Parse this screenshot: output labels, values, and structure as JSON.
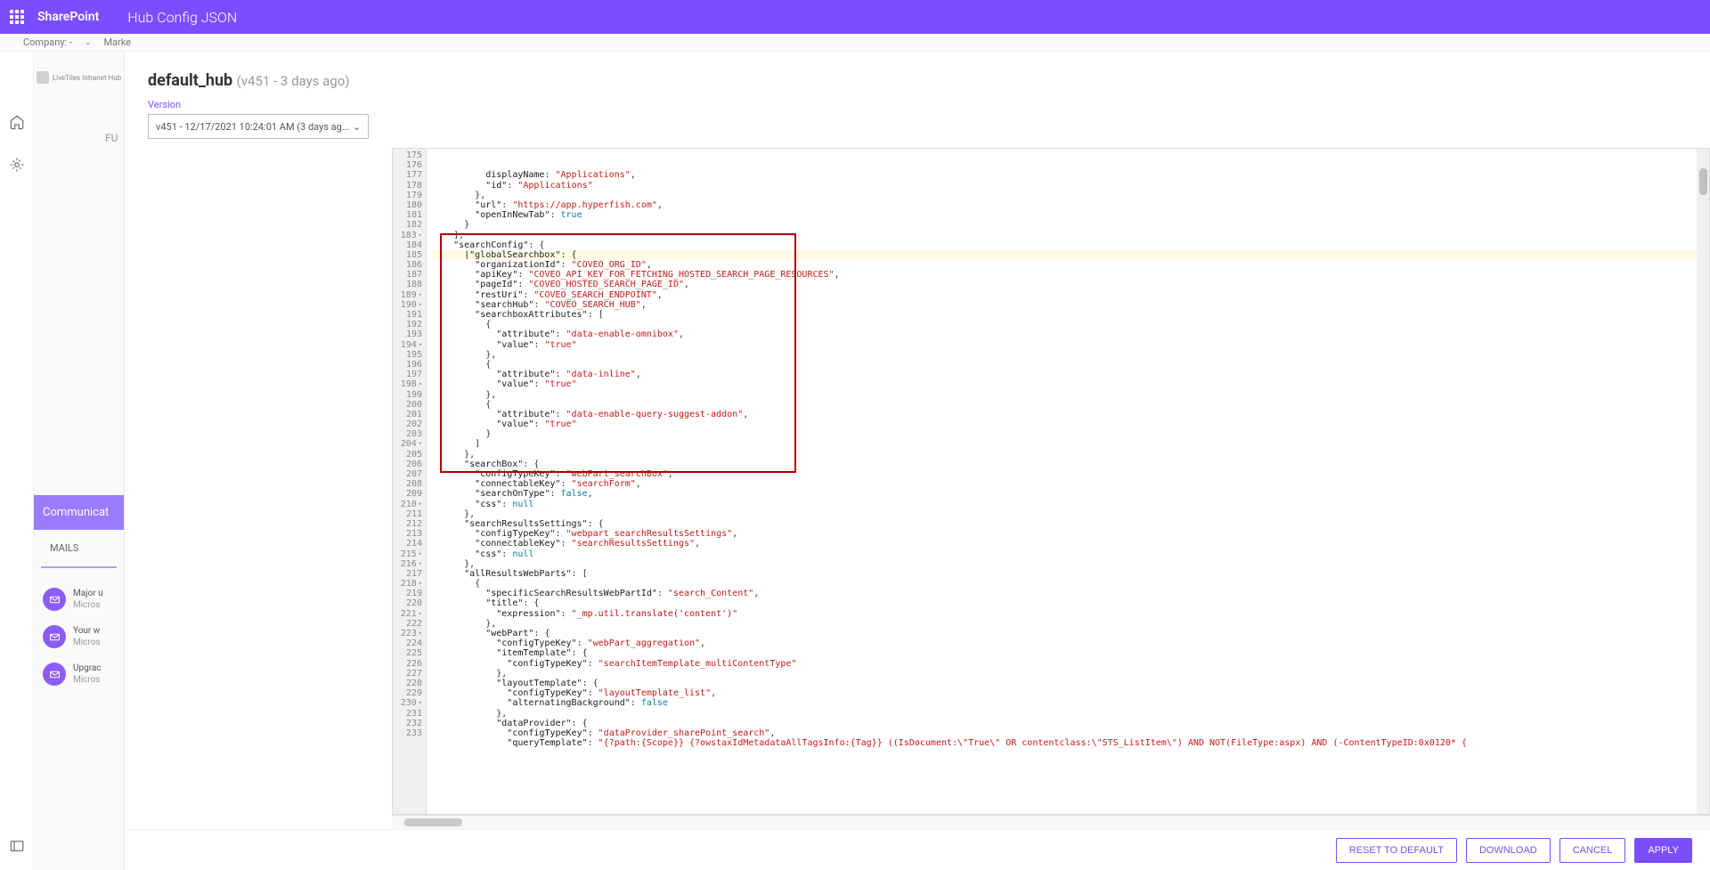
{
  "banner": {
    "brand": "SharePoint",
    "title": "Hub Config JSON"
  },
  "subBanner": {
    "company": "Company: -",
    "marke": "Marke"
  },
  "leftCol": {
    "logo": "LiveTiles Intranet Hub",
    "fu": "FU",
    "comm": "Communicat",
    "mails": "MAILS",
    "items": [
      {
        "t1": "Major u",
        "t2": "Micros"
      },
      {
        "t1": "Your w",
        "t2": "Micros"
      },
      {
        "t1": "Upgrac",
        "t2": "Micros"
      }
    ]
  },
  "panel": {
    "name": "default_hub",
    "sub": "(v451 - 3 days ago)",
    "versionLabel": "Version",
    "versionValue": "v451 - 12/17/2021 10:24:01 AM (3 days ag..."
  },
  "footer": {
    "reset": "RESET TO DEFAULT",
    "download": "DOWNLOAD",
    "cancel": "CANCEL",
    "apply": "APPLY"
  },
  "code": {
    "startLine": 175,
    "foldLines": [
      183,
      189,
      190,
      194,
      198,
      204,
      210,
      215,
      216,
      218,
      221,
      223,
      230
    ],
    "highlightLine": 183,
    "lines": [
      [
        [
          10,
          "k",
          "displayName"
        ],
        [
          0,
          "p",
          ": "
        ],
        [
          0,
          "s",
          "\"Applications\""
        ],
        [
          0,
          "p",
          ","
        ]
      ],
      [
        [
          10,
          "k",
          "\"id\""
        ],
        [
          0,
          "p",
          ": "
        ],
        [
          0,
          "s",
          "\"Applications\""
        ]
      ],
      [
        [
          8,
          "p",
          "},"
        ]
      ],
      [
        [
          8,
          "k",
          "\"url\""
        ],
        [
          0,
          "p",
          ": "
        ],
        [
          0,
          "s",
          "\"https://app.hyperfish.com\""
        ],
        [
          0,
          "p",
          ","
        ]
      ],
      [
        [
          8,
          "k",
          "\"openInNewTab\""
        ],
        [
          0,
          "p",
          ": "
        ],
        [
          0,
          "b",
          "true"
        ]
      ],
      [
        [
          6,
          "p",
          "}"
        ]
      ],
      [
        [
          4,
          "p",
          "],"
        ]
      ],
      [
        [
          4,
          "k",
          "\"searchConfig\""
        ],
        [
          0,
          "p",
          ": {"
        ]
      ],
      [
        [
          6,
          "k",
          "|\"globalSearchbox\""
        ],
        [
          0,
          "p",
          ": {"
        ]
      ],
      [
        [
          8,
          "k",
          "\"organizationId\""
        ],
        [
          0,
          "p",
          ": "
        ],
        [
          0,
          "s",
          "\"COVEO_ORG_ID\""
        ],
        [
          0,
          "p",
          ","
        ]
      ],
      [
        [
          8,
          "k",
          "\"apiKey\""
        ],
        [
          0,
          "p",
          ": "
        ],
        [
          0,
          "s",
          "\"COVEO_API_KEY_FOR_FETCHING_HOSTED_SEARCH_PAGE_RESOURCES\""
        ],
        [
          0,
          "p",
          ","
        ]
      ],
      [
        [
          8,
          "k",
          "\"pageId\""
        ],
        [
          0,
          "p",
          ": "
        ],
        [
          0,
          "s",
          "\"COVEO_HOSTED_SEARCH_PAGE_ID\""
        ],
        [
          0,
          "p",
          ","
        ]
      ],
      [
        [
          8,
          "k",
          "\"restUri\""
        ],
        [
          0,
          "p",
          ": "
        ],
        [
          0,
          "s",
          "\"COVEO_SEARCH_ENDPOINT\""
        ],
        [
          0,
          "p",
          ","
        ]
      ],
      [
        [
          8,
          "k",
          "\"searchHub\""
        ],
        [
          0,
          "p",
          ": "
        ],
        [
          0,
          "s",
          "\"COVEO_SEARCH_HUB\""
        ],
        [
          0,
          "p",
          ","
        ]
      ],
      [
        [
          8,
          "k",
          "\"searchboxAttributes\""
        ],
        [
          0,
          "p",
          ": ["
        ]
      ],
      [
        [
          10,
          "p",
          "{"
        ]
      ],
      [
        [
          12,
          "k",
          "\"attribute\""
        ],
        [
          0,
          "p",
          ": "
        ],
        [
          0,
          "s",
          "\"data-enable-omnibox\""
        ],
        [
          0,
          "p",
          ","
        ]
      ],
      [
        [
          12,
          "k",
          "\"value\""
        ],
        [
          0,
          "p",
          ": "
        ],
        [
          0,
          "s",
          "\"true\""
        ]
      ],
      [
        [
          10,
          "p",
          "},"
        ]
      ],
      [
        [
          10,
          "p",
          "{"
        ]
      ],
      [
        [
          12,
          "k",
          "\"attribute\""
        ],
        [
          0,
          "p",
          ": "
        ],
        [
          0,
          "s",
          "\"data-inline\""
        ],
        [
          0,
          "p",
          ","
        ]
      ],
      [
        [
          12,
          "k",
          "\"value\""
        ],
        [
          0,
          "p",
          ": "
        ],
        [
          0,
          "s",
          "\"true\""
        ]
      ],
      [
        [
          10,
          "p",
          "},"
        ]
      ],
      [
        [
          10,
          "p",
          "{"
        ]
      ],
      [
        [
          12,
          "k",
          "\"attribute\""
        ],
        [
          0,
          "p",
          ": "
        ],
        [
          0,
          "s",
          "\"data-enable-query-suggest-addon\""
        ],
        [
          0,
          "p",
          ","
        ]
      ],
      [
        [
          12,
          "k",
          "\"value\""
        ],
        [
          0,
          "p",
          ": "
        ],
        [
          0,
          "s",
          "\"true\""
        ]
      ],
      [
        [
          10,
          "p",
          "}"
        ]
      ],
      [
        [
          8,
          "p",
          "]"
        ]
      ],
      [
        [
          6,
          "p",
          "},"
        ]
      ],
      [
        [
          6,
          "k",
          "\"searchBox\""
        ],
        [
          0,
          "p",
          ": {"
        ]
      ],
      [
        [
          8,
          "k",
          "\"configTypeKey\""
        ],
        [
          0,
          "p",
          ": "
        ],
        [
          0,
          "s",
          "\"webPart_searchBox\""
        ],
        [
          0,
          "p",
          ","
        ]
      ],
      [
        [
          8,
          "k",
          "\"connectableKey\""
        ],
        [
          0,
          "p",
          ": "
        ],
        [
          0,
          "s",
          "\"searchForm\""
        ],
        [
          0,
          "p",
          ","
        ]
      ],
      [
        [
          8,
          "k",
          "\"searchOnType\""
        ],
        [
          0,
          "p",
          ": "
        ],
        [
          0,
          "b",
          "false"
        ],
        [
          0,
          "p",
          ","
        ]
      ],
      [
        [
          8,
          "k",
          "\"css\""
        ],
        [
          0,
          "p",
          ": "
        ],
        [
          0,
          "b",
          "null"
        ]
      ],
      [
        [
          6,
          "p",
          "},"
        ]
      ],
      [
        [
          6,
          "k",
          "\"searchResultsSettings\""
        ],
        [
          0,
          "p",
          ": {"
        ]
      ],
      [
        [
          8,
          "k",
          "\"configTypeKey\""
        ],
        [
          0,
          "p",
          ": "
        ],
        [
          0,
          "s",
          "\"webpart_searchResultsSettings\""
        ],
        [
          0,
          "p",
          ","
        ]
      ],
      [
        [
          8,
          "k",
          "\"connectableKey\""
        ],
        [
          0,
          "p",
          ": "
        ],
        [
          0,
          "s",
          "\"searchResultsSettings\""
        ],
        [
          0,
          "p",
          ","
        ]
      ],
      [
        [
          8,
          "k",
          "\"css\""
        ],
        [
          0,
          "p",
          ": "
        ],
        [
          0,
          "b",
          "null"
        ]
      ],
      [
        [
          6,
          "p",
          "},"
        ]
      ],
      [
        [
          6,
          "k",
          "\"allResultsWebParts\""
        ],
        [
          0,
          "p",
          ": ["
        ]
      ],
      [
        [
          8,
          "p",
          "{"
        ]
      ],
      [
        [
          10,
          "k",
          "\"specificSearchResultsWebPartId\""
        ],
        [
          0,
          "p",
          ": "
        ],
        [
          0,
          "s",
          "\"search_Content\""
        ],
        [
          0,
          "p",
          ","
        ]
      ],
      [
        [
          10,
          "k",
          "\"title\""
        ],
        [
          0,
          "p",
          ": {"
        ]
      ],
      [
        [
          12,
          "k",
          "\"expression\""
        ],
        [
          0,
          "p",
          ": "
        ],
        [
          0,
          "s",
          "\"_mp.util.translate('content')\""
        ]
      ],
      [
        [
          10,
          "p",
          "},"
        ]
      ],
      [
        [
          10,
          "k",
          "\"webPart\""
        ],
        [
          0,
          "p",
          ": {"
        ]
      ],
      [
        [
          12,
          "k",
          "\"configTypeKey\""
        ],
        [
          0,
          "p",
          ": "
        ],
        [
          0,
          "s",
          "\"webPart_aggregation\""
        ],
        [
          0,
          "p",
          ","
        ]
      ],
      [
        [
          12,
          "k",
          "\"itemTemplate\""
        ],
        [
          0,
          "p",
          ": {"
        ]
      ],
      [
        [
          14,
          "k",
          "\"configTypeKey\""
        ],
        [
          0,
          "p",
          ": "
        ],
        [
          0,
          "s",
          "\"searchItemTemplate_multiContentType\""
        ]
      ],
      [
        [
          12,
          "p",
          "},"
        ]
      ],
      [
        [
          12,
          "k",
          "\"layoutTemplate\""
        ],
        [
          0,
          "p",
          ": {"
        ]
      ],
      [
        [
          14,
          "k",
          "\"configTypeKey\""
        ],
        [
          0,
          "p",
          ": "
        ],
        [
          0,
          "s",
          "\"layoutTemplate_list\""
        ],
        [
          0,
          "p",
          ","
        ]
      ],
      [
        [
          14,
          "k",
          "\"alternatingBackground\""
        ],
        [
          0,
          "p",
          ": "
        ],
        [
          0,
          "b",
          "false"
        ]
      ],
      [
        [
          12,
          "p",
          "},"
        ]
      ],
      [
        [
          12,
          "k",
          "\"dataProvider\""
        ],
        [
          0,
          "p",
          ": {"
        ]
      ],
      [
        [
          14,
          "k",
          "\"configTypeKey\""
        ],
        [
          0,
          "p",
          ": "
        ],
        [
          0,
          "s",
          "\"dataProvider_sharePoint_search\""
        ],
        [
          0,
          "p",
          ","
        ]
      ],
      [
        [
          14,
          "k",
          "\"queryTemplate\""
        ],
        [
          0,
          "p",
          ": "
        ],
        [
          0,
          "s",
          "\"{?path:{Scope}} {?owstaxIdMetadataAllTagsInfo:{Tag}} ((IsDocument:\\\"True\\\" OR contentclass:\\\"STS_ListItem\\\") AND NOT(FileType:aspx) AND (-ContentTypeID:0x0120* {"
        ]
      ],
      [
        [
          0,
          "p",
          ""
        ]
      ]
    ]
  }
}
